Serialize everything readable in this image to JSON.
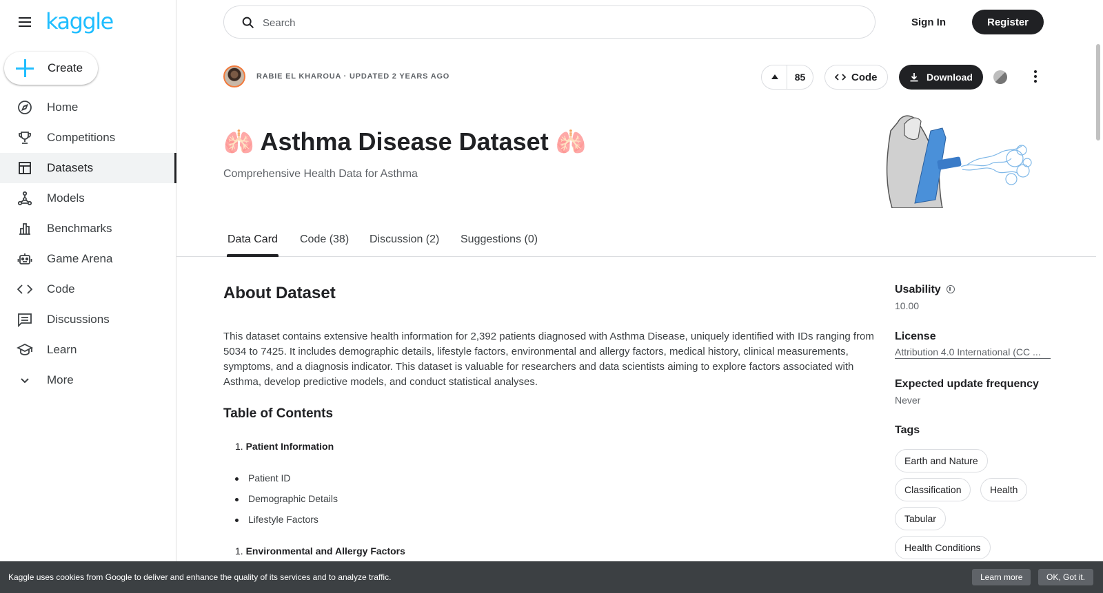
{
  "sidebar": {
    "logo": "kaggle",
    "create_label": "Create",
    "items": [
      {
        "label": "Home",
        "icon": "compass-icon"
      },
      {
        "label": "Competitions",
        "icon": "trophy-icon"
      },
      {
        "label": "Datasets",
        "icon": "table-icon",
        "active": true
      },
      {
        "label": "Models",
        "icon": "models-icon"
      },
      {
        "label": "Benchmarks",
        "icon": "bar-chart-icon"
      },
      {
        "label": "Game Arena",
        "icon": "robot-icon"
      },
      {
        "label": "Code",
        "icon": "code-icon"
      },
      {
        "label": "Discussions",
        "icon": "comment-icon"
      },
      {
        "label": "Learn",
        "icon": "school-icon"
      },
      {
        "label": "More",
        "icon": "chevron-down-icon"
      }
    ]
  },
  "header": {
    "search_placeholder": "Search",
    "signin_label": "Sign In",
    "register_label": "Register"
  },
  "dataset": {
    "author_line": "RABIE EL KHAROUA · UPDATED 2 YEARS AGO",
    "votes": "85",
    "code_label": "Code",
    "download_label": "Download",
    "title": "🫁 Asthma Disease Dataset 🫁",
    "subtitle": "Comprehensive Health Data for Asthma"
  },
  "tabs": [
    "Data Card",
    "Code (38)",
    "Discussion (2)",
    "Suggestions (0)"
  ],
  "content": {
    "about_heading": "About Dataset",
    "description": "This dataset contains extensive health information for 2,392 patients diagnosed with Asthma Disease, uniquely identified with IDs ranging from 5034 to 7425. It includes demographic details, lifestyle factors, environmental and allergy factors, medical history, clinical measurements, symptoms, and a diagnosis indicator. This dataset is valuable for researchers and data scientists aiming to explore factors associated with Asthma, develop predictive models, and conduct statistical analyses.",
    "toc_heading": "Table of Contents",
    "toc_section_1": "Patient Information",
    "toc_section_1_number": "1.",
    "toc_section_1_items": [
      "Patient ID",
      "Demographic Details",
      "Lifestyle Factors"
    ],
    "toc_section_2": "Environmental and Allergy Factors",
    "toc_section_2_number": "1."
  },
  "aside": {
    "usability_label": "Usability",
    "usability_value": "10.00",
    "license_label": "License",
    "license_value": "Attribution 4.0 International (CC ...",
    "update_label": "Expected update frequency",
    "update_value": "Never",
    "tags_label": "Tags",
    "tags": [
      "Earth and Nature",
      "Classification",
      "Health",
      "Tabular",
      "Health Conditions"
    ]
  },
  "cookie": {
    "text": "Kaggle uses cookies from Google to deliver and enhance the quality of its services and to analyze traffic.",
    "learn_more": "Learn more",
    "ok": "OK, Got it."
  },
  "colors": {
    "brand": "#20beff",
    "primary_dark": "#202124",
    "avatar_ring": "#f27a3c"
  }
}
